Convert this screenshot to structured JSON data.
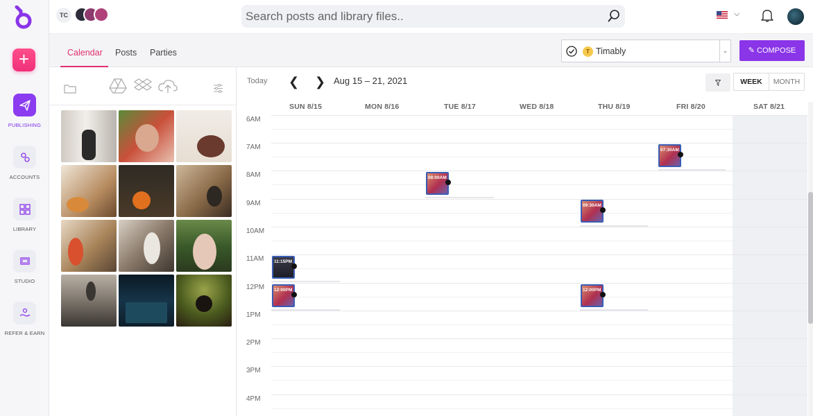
{
  "rail": {
    "add_label": "+",
    "items": [
      {
        "label": "PUBLISHING",
        "icon": "send-icon",
        "active": true
      },
      {
        "label": "ACCOUNTS",
        "icon": "accounts-icon"
      },
      {
        "label": "LIBRARY",
        "icon": "grid-icon"
      },
      {
        "label": "STUDIO",
        "icon": "studio-icon"
      },
      {
        "label": "REFER & EARN",
        "icon": "hand-coin-icon"
      }
    ]
  },
  "topbar": {
    "team_initials": "TC",
    "search_placeholder": "Search posts and library files.."
  },
  "subbar": {
    "tabs": [
      "Calendar",
      "Posts",
      "Parties"
    ],
    "active_tab": "Calendar",
    "account_initial": "T",
    "account_name": "Timably",
    "compose_label": "COMPOSE"
  },
  "calendar": {
    "today_label": "Today",
    "range": "Aug 15 – 21, 2021",
    "views": [
      "WEEK",
      "MONTH"
    ],
    "active_view": "WEEK",
    "days": [
      "SUN 8/15",
      "MON 8/16",
      "TUE 8/17",
      "WED 8/18",
      "THU 8/19",
      "FRI 8/20",
      "SAT 8/21"
    ],
    "hours": [
      "6AM",
      "7AM",
      "8AM",
      "9AM",
      "10AM",
      "11AM",
      "12PM",
      "1PM",
      "2PM",
      "3PM",
      "4PM"
    ],
    "posts": [
      {
        "day": "FRI 8/20",
        "time": "07:30AM"
      },
      {
        "day": "TUE 8/17",
        "time": "08:00AM"
      },
      {
        "day": "THU 8/19",
        "time": "09:30AM"
      },
      {
        "day": "SUN 8/15",
        "time": "11:15PM"
      },
      {
        "day": "SUN 8/15",
        "time": "12:00PM"
      },
      {
        "day": "THU 8/19",
        "time": "12:00PM"
      }
    ]
  },
  "colors": {
    "brand_purple": "#8a35e8",
    "accent_pink": "#e0306f"
  }
}
